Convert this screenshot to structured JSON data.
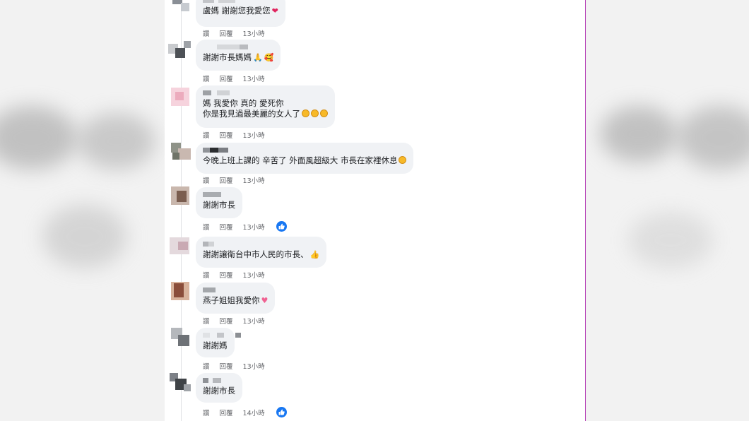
{
  "labels": {
    "like": "讚",
    "reply": "回覆"
  },
  "comments": [
    {
      "text": "盧媽 謝謝您我愛您",
      "emoji": "heart",
      "time": "13小時",
      "liked": false
    },
    {
      "text": "謝謝市長媽媽",
      "emoji": "pray-hearts",
      "time": "13小時",
      "liked": false
    },
    {
      "lines": [
        "媽 我愛你 真的 愛死你",
        "你是我見過最美麗的女人了"
      ],
      "emoji": "crying-faces",
      "time": "13小時",
      "liked": false
    },
    {
      "text": "今晚上班上課的 辛苦了 外面風超級大 市長在家裡休息",
      "emoji": "face",
      "time": "13小時",
      "liked": false
    },
    {
      "text": "謝謝市長",
      "time": "13小時",
      "liked": true
    },
    {
      "text": "謝謝讓衛台中市人民的市長、",
      "emoji": "thumbs-up",
      "time": "13小時",
      "liked": false
    },
    {
      "text": "燕子姐姐我愛你",
      "emoji": "pink-heart",
      "time": "13小時",
      "liked": false
    },
    {
      "text": "謝謝媽",
      "time": "13小時",
      "liked": false
    },
    {
      "text": "謝謝市長",
      "time": "14小時",
      "liked": true
    }
  ],
  "colors": {
    "accent": "#1877f2",
    "bubble": "#f0f2f5",
    "meta_text": "#65676b",
    "divider": "#b43db5"
  }
}
